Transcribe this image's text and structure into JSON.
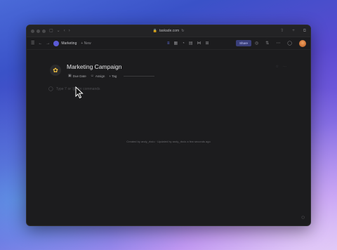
{
  "browser": {
    "url": "taskade.com"
  },
  "toolbar": {
    "workspace_name": "Marketing",
    "new_label": "+ New",
    "share_label": "Share"
  },
  "page": {
    "title": "Marketing Campaign",
    "icon": "sunflower-icon",
    "properties": [
      {
        "icon": "calendar-icon",
        "label": "Due Date"
      },
      {
        "icon": "person-icon",
        "label": "Assign"
      },
      {
        "icon": "plus-icon",
        "label": "+ Tag"
      }
    ],
    "comment_placeholder": "Type '/' or '@' for commands",
    "footer_note": "Created by andy_rbcio · Updated by andy_rbcio a few seconds ago"
  },
  "colors": {
    "accent": "#6c7cff",
    "window_bg": "#1c1c1e"
  }
}
